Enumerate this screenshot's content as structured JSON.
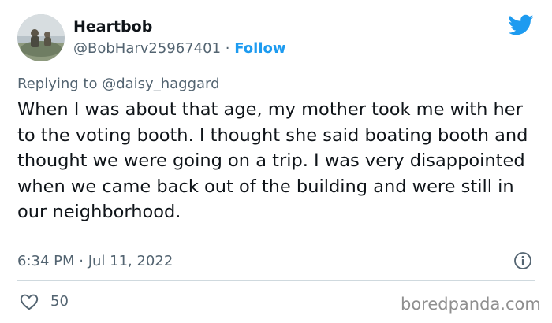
{
  "tweet": {
    "author": {
      "name": "Heartbob",
      "handle": "@BobHarv25967401",
      "separator": "·",
      "follow_label": "Follow",
      "avatar_icon": "avatar-photo"
    },
    "reply": {
      "prefix": "Replying to",
      "mention": "@daisy_haggard"
    },
    "text": "When I was about that age, my mother took me with her to the voting booth. I thought she said boating booth and thought we were going on a trip. I was very disappointed when we came back out of the building and were still in our neighborhood.",
    "timestamp": "6:34 PM · Jul 11, 2022",
    "likes": "50",
    "icons": {
      "brand": "twitter-bird-icon",
      "info": "info-icon",
      "like": "heart-icon"
    },
    "colors": {
      "accent": "#1d9bf0",
      "secondary_text": "#536471",
      "divider": "#cfd9de"
    }
  },
  "watermark": "boredpanda.com"
}
